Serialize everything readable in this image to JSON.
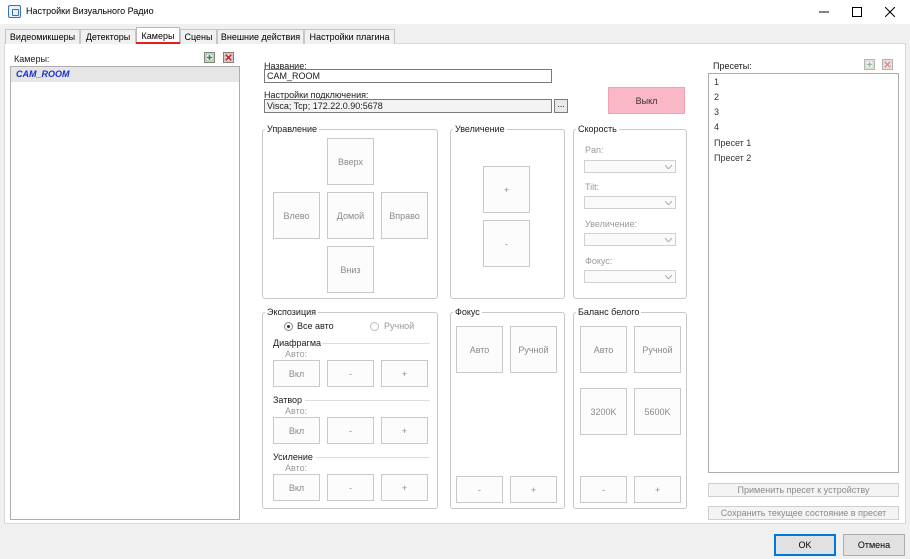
{
  "window": {
    "title": "Настройки Визуального Радио"
  },
  "tabs": [
    {
      "label": "Видеомикшеры"
    },
    {
      "label": "Детекторы"
    },
    {
      "label": "Камеры"
    },
    {
      "label": "Сцены"
    },
    {
      "label": "Внешние действия"
    },
    {
      "label": "Настройки плагина"
    }
  ],
  "cameras": {
    "label": "Камеры:",
    "items": [
      "CAM_ROOM"
    ]
  },
  "camera": {
    "name_label": "Название:",
    "name_value": "CAM_ROOM",
    "connection_label": "Настройки подключения:",
    "connection_value": "Visca; Tcp; 172.22.0.90:5678",
    "browse_label": "...",
    "status_label": "Выкл"
  },
  "control": {
    "title": "Управление",
    "up": "Вверх",
    "left": "Влево",
    "home": "Домой",
    "right": "Вправо",
    "down": "Вниз"
  },
  "zoom": {
    "title": "Увеличение",
    "plus": "+",
    "minus": "-"
  },
  "speed": {
    "title": "Скорость",
    "pan": "Pan:",
    "tilt": "Tilt:",
    "zoom": "Увеличение:",
    "focus": "Фокус:"
  },
  "exposure": {
    "title": "Экспозиция",
    "all_auto": "Все авто",
    "manual": "Ручной",
    "iris": {
      "title": "Диафрагма",
      "auto": "Авто:",
      "on": "Вкл",
      "minus": "-",
      "plus": "+"
    },
    "shutter": {
      "title": "Затвор",
      "auto": "Авто:",
      "on": "Вкл",
      "minus": "-",
      "plus": "+"
    },
    "gain": {
      "title": "Усиление",
      "auto": "Авто:",
      "on": "Вкл",
      "minus": "-",
      "plus": "+"
    }
  },
  "focus": {
    "title": "Фокус",
    "auto": "Авто",
    "manual": "Ручной",
    "minus": "-",
    "plus": "+"
  },
  "white_balance": {
    "title": "Баланс белого",
    "auto": "Авто",
    "manual": "Ручной",
    "k3200": "3200K",
    "k5600": "5600K",
    "minus": "-",
    "plus": "+"
  },
  "presets": {
    "label": "Пресеты:",
    "items": [
      "1",
      "2",
      "3",
      "4",
      "Пресет 1",
      "Пресет 2"
    ],
    "apply_label": "Применить пресет к устройству",
    "save_label": "Сохранить текущее состояние в пресет"
  },
  "footer": {
    "ok": "OK",
    "cancel": "Отмена"
  }
}
